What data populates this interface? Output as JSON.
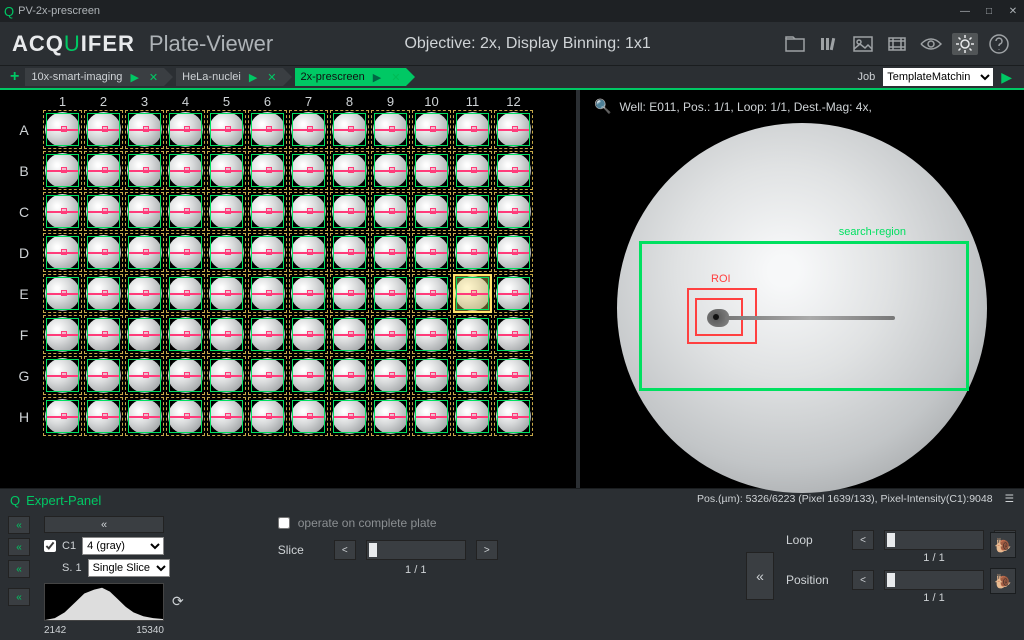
{
  "window": {
    "title": "PV-2x-prescreen"
  },
  "header": {
    "app_name_prefix": "ACQ",
    "app_name_u": "U",
    "app_name_suffix": "IFER",
    "app_subtitle": "Plate-Viewer",
    "objective_line": "Objective: 2x, Display Binning: 1x1"
  },
  "breadcrumbs": {
    "items": [
      {
        "label": "10x-smart-imaging",
        "active": false
      },
      {
        "label": "HeLa-nuclei",
        "active": false
      },
      {
        "label": "2x-prescreen",
        "active": true
      }
    ],
    "job_label": "Job",
    "job_selected": "TemplateMatchin"
  },
  "plate": {
    "cols": [
      "1",
      "2",
      "3",
      "4",
      "5",
      "6",
      "7",
      "8",
      "9",
      "10",
      "11",
      "12"
    ],
    "rows": [
      "A",
      "B",
      "C",
      "D",
      "E",
      "F",
      "G",
      "H"
    ],
    "selected": "E11"
  },
  "detail": {
    "header": "Well: E011, Pos.: 1/1, Loop: 1/1, Dest.-Mag: 4x,",
    "roi_label": "ROI",
    "search_region_label": "search-region"
  },
  "status_bar": {
    "left_label": "Expert-Panel",
    "right_text": "Pos.(µm): 5326/6223 (Pixel 1639/133), Pixel-Intensity(C1):9048"
  },
  "expert": {
    "operate_label": "operate on complete plate",
    "c1_label": "C1",
    "c1_lut_selected": "4 (gray)",
    "s1_label": "S. 1",
    "slice_mode_selected": "Single Slice",
    "hist_min": "2142",
    "hist_max": "15340",
    "slice": {
      "label": "Slice",
      "value": "1 / 1"
    },
    "loop": {
      "label": "Loop",
      "value": "1 / 1"
    },
    "position": {
      "label": "Position",
      "value": "1 / 1"
    }
  }
}
